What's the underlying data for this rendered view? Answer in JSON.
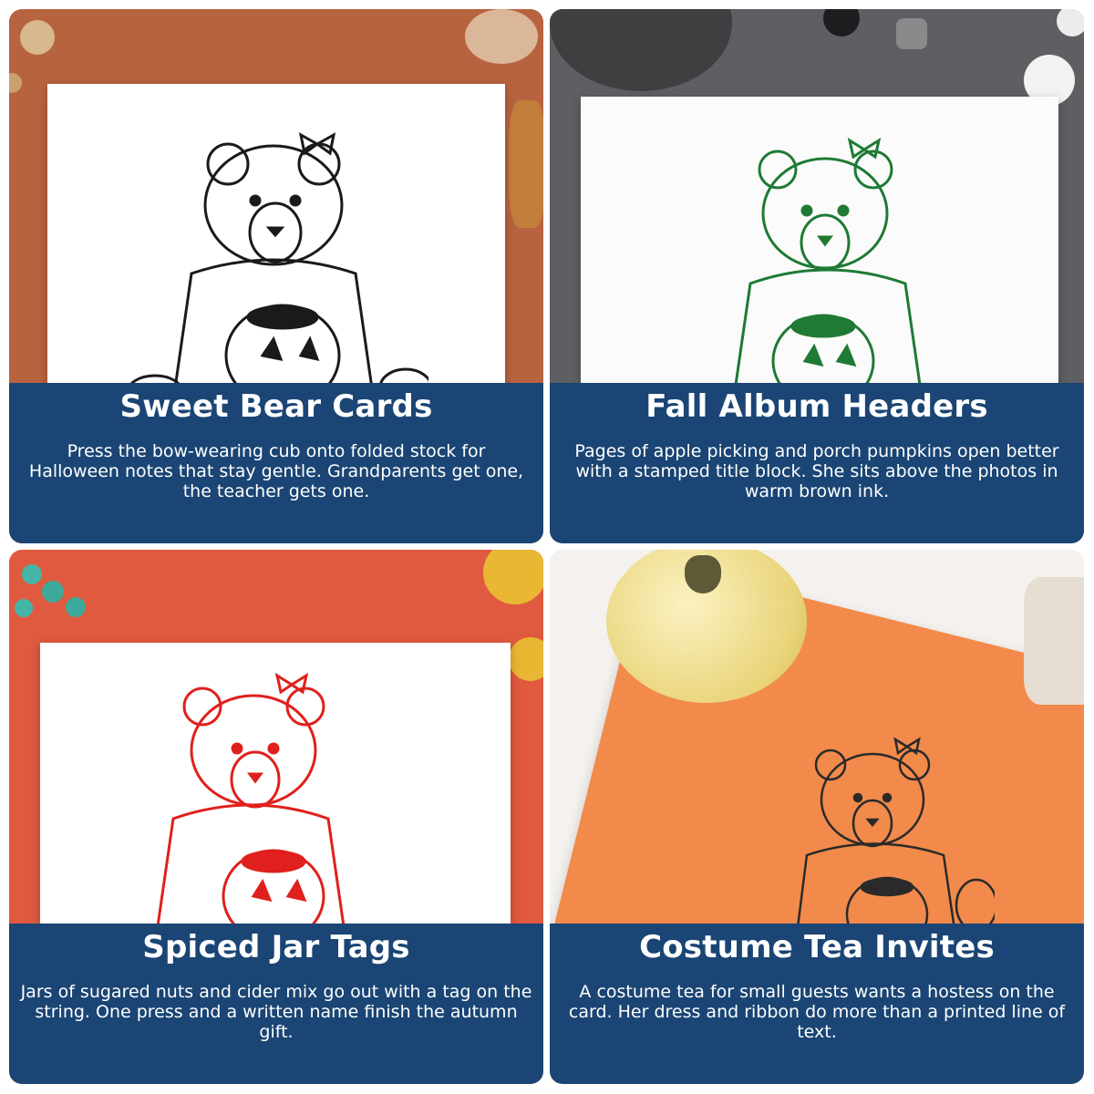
{
  "cards": [
    {
      "title": "Sweet Bear Cards",
      "body": "Press the bow-wearing cub onto folded stock for Halloween notes that stay gentle. Grandparents get one, the teacher gets one.",
      "ink_color": "#1a1a1a",
      "background": "rust linen"
    },
    {
      "title": "Fall Album Headers",
      "body": "Pages of apple picking and porch pumpkins open better with a stamped title block. She sits above the photos in warm brown ink.",
      "ink_color": "#1f7a34",
      "background": "grey felt"
    },
    {
      "title": "Spiced Jar Tags",
      "body": "Jars of sugared nuts and cider mix go out with a tag on the string. One press and a written name finish the autumn gift.",
      "ink_color": "#e0201c",
      "background": "coral felt"
    },
    {
      "title": "Costume Tea Invites",
      "body": "A costume tea for small guests wants a hostess on the card. Her dress and ribbon do more than a printed line of text.",
      "ink_color": "#2a2a2a",
      "background": "orange paper"
    }
  ],
  "colors": {
    "panel": "#1a4574",
    "panel_text": "#ffffff"
  }
}
